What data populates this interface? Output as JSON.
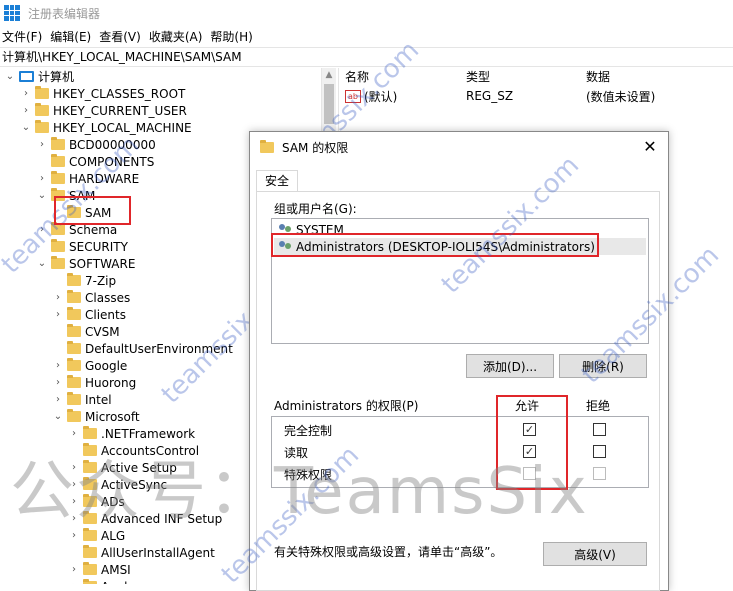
{
  "window": {
    "title": "注册表编辑器"
  },
  "menu": [
    "文件(F)",
    "编辑(E)",
    "查看(V)",
    "收藏夹(A)",
    "帮助(H)"
  ],
  "address": "计算机\\HKEY_LOCAL_MACHINE\\SAM\\SAM",
  "tree": [
    {
      "label": "计算机",
      "type": "pc",
      "chev": "v"
    },
    {
      "label": "HKEY_CLASSES_ROOT",
      "type": "folder",
      "chev": ">"
    },
    {
      "label": "HKEY_CURRENT_USER",
      "type": "folder",
      "chev": ">"
    },
    {
      "label": "HKEY_LOCAL_MACHINE",
      "type": "folder",
      "chev": "v"
    },
    {
      "label": "BCD00000000",
      "type": "folder",
      "chev": ">"
    },
    {
      "label": "COMPONENTS",
      "type": "folder",
      "chev": ""
    },
    {
      "label": "HARDWARE",
      "type": "folder",
      "chev": ">"
    },
    {
      "label": "SAM",
      "type": "folder",
      "chev": "v"
    },
    {
      "label": "SAM",
      "type": "folder",
      "chev": ""
    },
    {
      "label": "Schema",
      "type": "folder",
      "chev": ">"
    },
    {
      "label": "SECURITY",
      "type": "folder",
      "chev": ""
    },
    {
      "label": "SOFTWARE",
      "type": "folder",
      "chev": "v"
    },
    {
      "label": "7-Zip",
      "type": "folder",
      "chev": ""
    },
    {
      "label": "Classes",
      "type": "folder",
      "chev": ">"
    },
    {
      "label": "Clients",
      "type": "folder",
      "chev": ">"
    },
    {
      "label": "CVSM",
      "type": "folder",
      "chev": ""
    },
    {
      "label": "DefaultUserEnvironment",
      "type": "folder",
      "chev": ""
    },
    {
      "label": "Google",
      "type": "folder",
      "chev": ">"
    },
    {
      "label": "Huorong",
      "type": "folder",
      "chev": ">"
    },
    {
      "label": "Intel",
      "type": "folder",
      "chev": ">"
    },
    {
      "label": "Microsoft",
      "type": "folder",
      "chev": "v"
    },
    {
      "label": ".NETFramework",
      "type": "folder",
      "chev": ">"
    },
    {
      "label": "AccountsControl",
      "type": "folder",
      "chev": ""
    },
    {
      "label": "Active Setup",
      "type": "folder",
      "chev": ">"
    },
    {
      "label": "ActiveSync",
      "type": "folder",
      "chev": ">"
    },
    {
      "label": "ADs",
      "type": "folder",
      "chev": ">"
    },
    {
      "label": "Advanced INF Setup",
      "type": "folder",
      "chev": ">"
    },
    {
      "label": "ALG",
      "type": "folder",
      "chev": ">"
    },
    {
      "label": "AllUserInstallAgent",
      "type": "folder",
      "chev": ""
    },
    {
      "label": "AMSI",
      "type": "folder",
      "chev": ">"
    },
    {
      "label": "Analog",
      "type": "folder",
      "chev": ">"
    }
  ],
  "list": {
    "headers": {
      "name": "名称",
      "type": "类型",
      "data": "数据"
    },
    "rows": [
      {
        "name": "(默认)",
        "type": "REG_SZ",
        "data": "(数值未设置)"
      }
    ]
  },
  "dialog": {
    "title": "SAM 的权限",
    "close": "✕",
    "tab": "安全",
    "group_label": "组或用户名(G):",
    "users": [
      "SYSTEM",
      "Administrators (DESKTOP-IOLI54S\\Administrators)"
    ],
    "add_button": "添加(D)...",
    "remove_button": "删除(R)",
    "perm_label": "Administrators 的权限(P)",
    "allow_header": "允许",
    "deny_header": "拒绝",
    "permissions": [
      {
        "name": "完全控制",
        "allow": true,
        "deny": false,
        "disabled": false
      },
      {
        "name": "读取",
        "allow": true,
        "deny": false,
        "disabled": false
      },
      {
        "name": "特殊权限",
        "allow": false,
        "deny": false,
        "disabled": true
      }
    ],
    "advanced_note": "有关特殊权限或高级设置，请单击“高级”。",
    "advanced_button": "高级(V)"
  },
  "watermark": {
    "site": "teamssix.com",
    "banner": "公众号：TeamsSix"
  },
  "colors": {
    "folder": "#f1c85c",
    "highlight": "#e0262a",
    "watermark": "#3c5fc4"
  }
}
